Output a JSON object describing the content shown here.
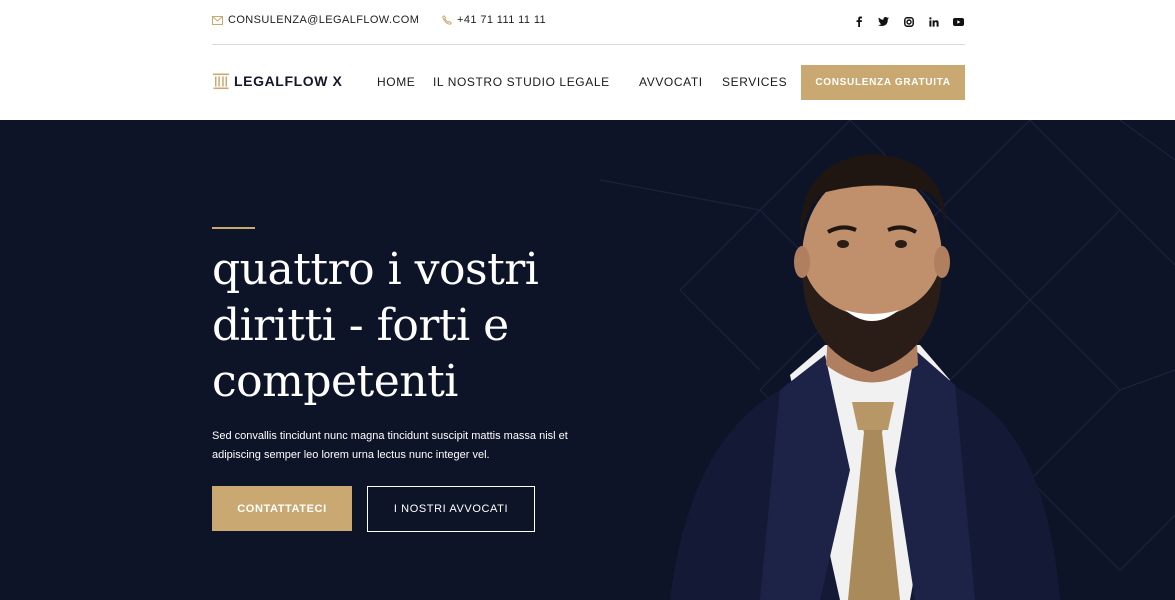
{
  "topbar": {
    "email": "CONSULENZA@LEGALFLOW.COM",
    "phone": "+41 71 111 11 11",
    "socials": [
      "facebook-icon",
      "twitter-icon",
      "instagram-icon",
      "linkedin-icon",
      "youtube-icon"
    ]
  },
  "nav": {
    "logo": "LEGALFLOW X",
    "items": [
      {
        "label": "HOME"
      },
      {
        "label": "IL NOSTRO STUDIO LEGALE"
      },
      {
        "label": "AVVOCATI"
      },
      {
        "label": "SERVICES"
      }
    ],
    "cta": "CONSULENZA GRATUITA"
  },
  "hero": {
    "headline": "quattro i vostri diritti - forti e competenti",
    "subtext": "Sed convallis tincidunt nunc magna tincidunt suscipit mattis massa nisl et adipiscing semper leo lorem urna lectus nunc integer vel.",
    "primary_button": "CONTATTATECI",
    "secondary_button": "I NOSTRI AVVOCATI"
  },
  "colors": {
    "accent": "#c9a871",
    "hero_bg": "#0e1428"
  }
}
